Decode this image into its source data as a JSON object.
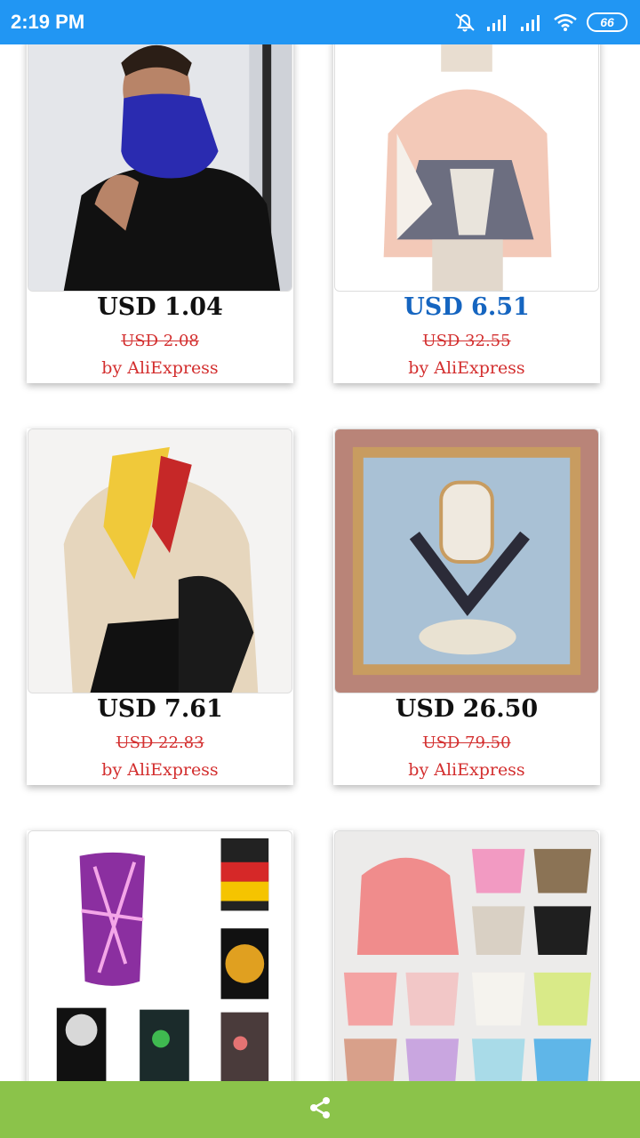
{
  "status_bar": {
    "time": "2:19 PM",
    "battery": "66",
    "icons": [
      "mute-icon",
      "signal-icon",
      "signal-icon",
      "wifi-icon",
      "battery-icon"
    ]
  },
  "products": [
    {
      "price": "USD 1.04",
      "old_price": "USD 2.08",
      "seller": "by AliExpress",
      "image": "man-wearing-blue-neck-gaiter"
    },
    {
      "price": "USD 6.51",
      "old_price": "USD 32.55",
      "seller": "by AliExpress",
      "image": "pink-grey-plaid-scarf-on-mannequin"
    },
    {
      "price": "USD 7.61",
      "old_price": "USD 22.83",
      "seller": "by AliExpress",
      "image": "woman-wearing-yellow-silk-scarf"
    },
    {
      "price": "USD 26.50",
      "old_price": "USD 79.50",
      "seller": "by AliExpress",
      "image": "square-silk-scarf-blue-pattern"
    },
    {
      "price": "",
      "old_price": "",
      "seller": "",
      "image": "printed-neck-gaiter-collection"
    },
    {
      "price": "",
      "old_price": "",
      "seller": "",
      "image": "lace-triangle-scarf-colors"
    }
  ],
  "colors": {
    "status_bar": "#2196f3",
    "bottom_bar": "#8bc34a",
    "price_highlight": "#1565c0",
    "sale_red": "#d32f2f"
  },
  "bottom_bar": {
    "icon": "share-icon"
  }
}
